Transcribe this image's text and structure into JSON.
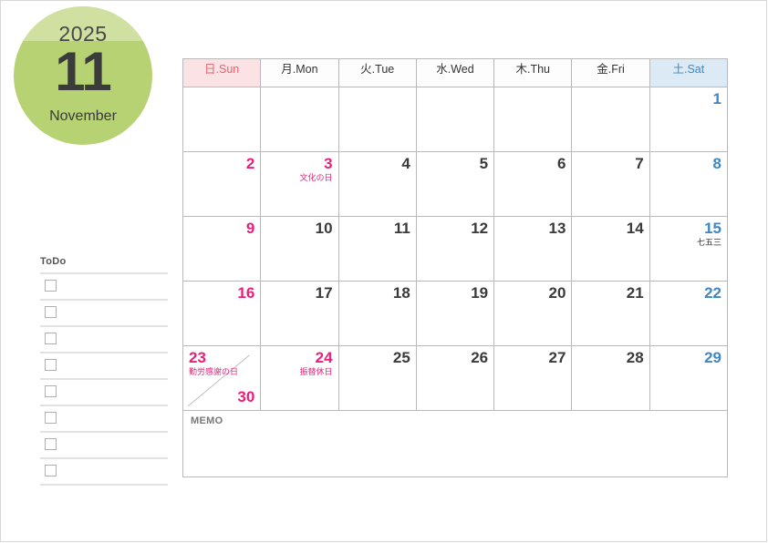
{
  "badge": {
    "year": "2025",
    "month_number": "11",
    "month_name": "November"
  },
  "todo": {
    "title": "ToDo",
    "rows": 8
  },
  "memo": {
    "label": "MEMO"
  },
  "calendar": {
    "weekday_headers": [
      {
        "label": "日.Sun",
        "kind": "sun"
      },
      {
        "label": "月.Mon",
        "kind": "weekday"
      },
      {
        "label": "火.Tue",
        "kind": "weekday"
      },
      {
        "label": "水.Wed",
        "kind": "weekday"
      },
      {
        "label": "木.Thu",
        "kind": "weekday"
      },
      {
        "label": "金.Fri",
        "kind": "weekday"
      },
      {
        "label": "土.Sat",
        "kind": "sat"
      }
    ],
    "weeks": [
      [
        {
          "day": "",
          "kind": "empty",
          "note": ""
        },
        {
          "day": "",
          "kind": "empty",
          "note": ""
        },
        {
          "day": "",
          "kind": "empty",
          "note": ""
        },
        {
          "day": "",
          "kind": "empty",
          "note": ""
        },
        {
          "day": "",
          "kind": "empty",
          "note": ""
        },
        {
          "day": "",
          "kind": "empty",
          "note": ""
        },
        {
          "day": "1",
          "kind": "sat",
          "note": ""
        }
      ],
      [
        {
          "day": "2",
          "kind": "sun",
          "note": ""
        },
        {
          "day": "3",
          "kind": "holiday",
          "note": "文化の日"
        },
        {
          "day": "4",
          "kind": "weekday",
          "note": ""
        },
        {
          "day": "5",
          "kind": "weekday",
          "note": ""
        },
        {
          "day": "6",
          "kind": "weekday",
          "note": ""
        },
        {
          "day": "7",
          "kind": "weekday",
          "note": ""
        },
        {
          "day": "8",
          "kind": "sat",
          "note": ""
        }
      ],
      [
        {
          "day": "9",
          "kind": "sun",
          "note": ""
        },
        {
          "day": "10",
          "kind": "weekday",
          "note": ""
        },
        {
          "day": "11",
          "kind": "weekday",
          "note": ""
        },
        {
          "day": "12",
          "kind": "weekday",
          "note": ""
        },
        {
          "day": "13",
          "kind": "weekday",
          "note": ""
        },
        {
          "day": "14",
          "kind": "weekday",
          "note": ""
        },
        {
          "day": "15",
          "kind": "sat",
          "note": "七五三",
          "note_plain": true
        }
      ],
      [
        {
          "day": "16",
          "kind": "sun",
          "note": ""
        },
        {
          "day": "17",
          "kind": "weekday",
          "note": ""
        },
        {
          "day": "18",
          "kind": "weekday",
          "note": ""
        },
        {
          "day": "19",
          "kind": "weekday",
          "note": ""
        },
        {
          "day": "20",
          "kind": "weekday",
          "note": ""
        },
        {
          "day": "21",
          "kind": "weekday",
          "note": ""
        },
        {
          "day": "22",
          "kind": "sat",
          "note": ""
        }
      ],
      [
        {
          "day": "23",
          "kind": "split",
          "note": "勤労感謝の日",
          "day2": "30"
        },
        {
          "day": "24",
          "kind": "holiday",
          "note": "振替休日"
        },
        {
          "day": "25",
          "kind": "weekday",
          "note": ""
        },
        {
          "day": "26",
          "kind": "weekday",
          "note": ""
        },
        {
          "day": "27",
          "kind": "weekday",
          "note": ""
        },
        {
          "day": "28",
          "kind": "weekday",
          "note": ""
        },
        {
          "day": "29",
          "kind": "sat",
          "note": ""
        }
      ]
    ]
  },
  "colors": {
    "badge_green": "#b6d272",
    "badge_green_light": "#cfe0a0",
    "sunday_header_bg": "#fbe2e4",
    "sunday_text": "#e8636f",
    "saturday_header_bg": "#dbeaf5",
    "saturday_text": "#3f86c4",
    "holiday_text": "#ec1e79",
    "grid_line": "#b9b9b9"
  }
}
